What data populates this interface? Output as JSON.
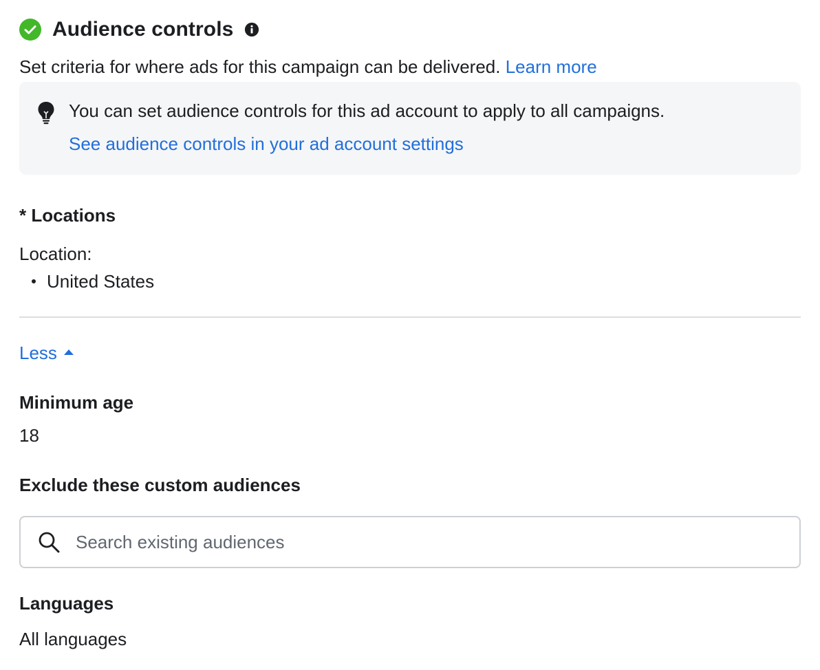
{
  "header": {
    "title": "Audience controls",
    "status_icon": "check-circle-icon",
    "info_icon": "info-icon"
  },
  "description": {
    "text": "Set criteria for where ads for this campaign can be delivered.",
    "link": "Learn more"
  },
  "notice": {
    "icon": "lightbulb-icon",
    "text": "You can set audience controls for this ad account to apply to all campaigns.",
    "link": "See audience controls in your ad account settings"
  },
  "locations": {
    "heading": "* Locations",
    "label": "Location:",
    "items": [
      "United States"
    ]
  },
  "toggle": {
    "label": "Less"
  },
  "minimum_age": {
    "heading": "Minimum age",
    "value": "18"
  },
  "exclude_audiences": {
    "heading": "Exclude these custom audiences",
    "placeholder": "Search existing audiences",
    "value": ""
  },
  "languages": {
    "heading": "Languages",
    "value": "All languages"
  },
  "colors": {
    "link": "#216fdb",
    "success": "#42b72a",
    "text": "#1c1e21",
    "notice_bg": "#f5f6f7"
  }
}
